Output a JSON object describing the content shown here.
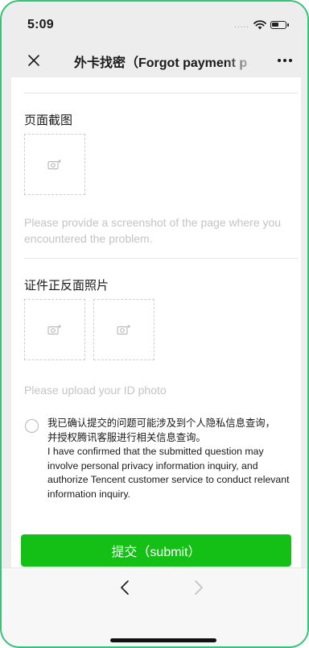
{
  "status_bar": {
    "time": "5:09",
    "signal": "....."
  },
  "nav": {
    "title": "外卡找密（Forgot payment p"
  },
  "screenshot_section": {
    "title": "页面截图",
    "hint": "Please provide a screenshot of the page where you encountered the problem."
  },
  "id_section": {
    "title": "证件正反面照片",
    "hint": "Please upload your ID photo"
  },
  "consent": {
    "line_cn_1": "我已确认提交的问题可能涉及到个人隐私信息查询，",
    "line_cn_2": "并授权腾讯客服进行相关信息查询。",
    "text_en": "I have confirmed that the submitted question may involve personal privacy information inquiry, and authorize Tencent customer service to conduct relevant information inquiry."
  },
  "submit": {
    "label": "提交（submit）"
  },
  "colors": {
    "accent": "#15c016",
    "frame": "#38c27a",
    "hint": "#c4c4c4",
    "background": "#ededed"
  },
  "icons": {
    "close": "close-icon",
    "more": "more-icon",
    "camera": "camera-add-icon",
    "back": "chevron-left-icon",
    "forward": "chevron-right-icon",
    "wifi": "wifi-icon",
    "battery": "battery-icon"
  }
}
